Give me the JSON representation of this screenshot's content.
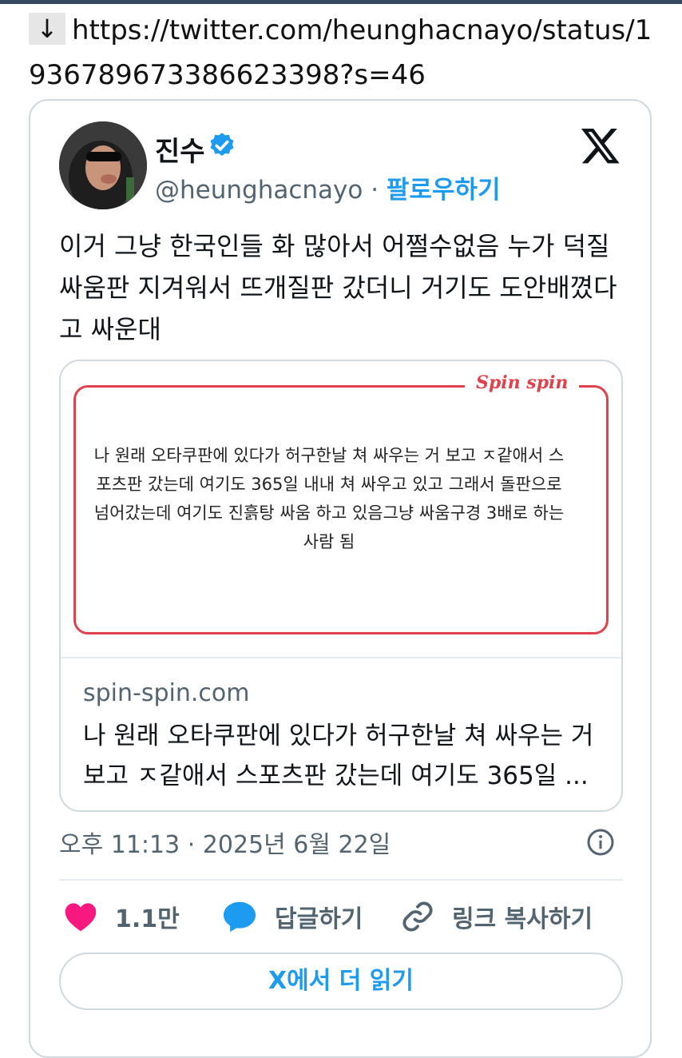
{
  "url": {
    "arrow": "↓",
    "text": "https://twitter.com/heunghacnayo/status/1936789673386623398?s=46"
  },
  "tweet": {
    "display_name": "진수",
    "handle": "@heunghacnayo",
    "separator": " · ",
    "follow_label": "팔로우하기",
    "text": "이거 그냥 한국인들 화 많아서 어쩔수없음 누가 덕질 싸움판 지겨워서 뜨개질판 갔더니 거기도 도안배꼈다고 싸운대",
    "timestamp": "오후 11:13 · 2025년 6월 22일"
  },
  "link_card": {
    "preview_logo": "Spin spin",
    "preview_text": "나 원래 오타쿠판에 있다가 허구한날 쳐 싸우는 거 보고 ㅈ같애서 스포츠판 갔는데 여기도 365일 내내 쳐 싸우고 있고 그래서 돌판으로 넘어갔는데 여기도 진흙탕 싸움 하고 있음그냥 싸움구경 3배로 하는 사람 됨",
    "domain": "spin-spin.com",
    "description": "나 원래 오타쿠판에 있다가 허구한날 쳐 싸우는 거 보고 ㅈ같애서 스포츠판 갔는데 여기도 365일 ..."
  },
  "actions": {
    "like_count": "1.1만",
    "reply_label": "답글하기",
    "copy_link_label": "링크 복사하기"
  },
  "read_more_label": "X에서 더 읽기",
  "colors": {
    "accent": "#1d9bf0",
    "like": "#f91880",
    "spin_red": "#e0414b",
    "muted": "#536471"
  }
}
